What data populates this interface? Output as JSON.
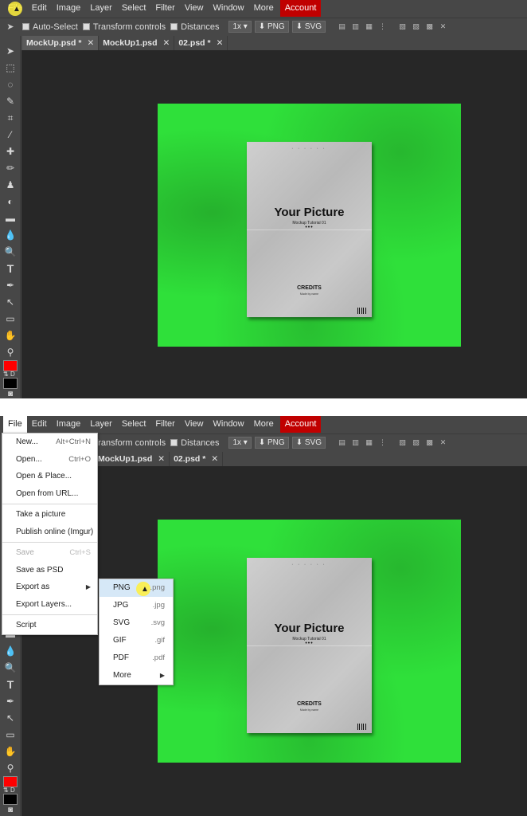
{
  "menubar": {
    "items": [
      "File",
      "Edit",
      "Image",
      "Layer",
      "Select",
      "Filter",
      "View",
      "Window",
      "More"
    ],
    "account": "Account"
  },
  "options": {
    "auto_select": "Auto-Select",
    "transform_controls": "Transform controls",
    "distances": "Distances",
    "zoom": "1x",
    "png": "PNG",
    "svg": "SVG"
  },
  "tabs": [
    {
      "label": "MockUp.psd *"
    },
    {
      "label": "MockUp1.psd"
    },
    {
      "label": "02.psd *"
    }
  ],
  "tabs_bottom": [
    {
      "label": "MockUp1.psd"
    },
    {
      "label": "02.psd *"
    }
  ],
  "colors": {
    "accent": "#c00000",
    "foreground_swatch": "#ff0000",
    "background_swatch": "#000000",
    "canvas_green": "#2fe03a"
  },
  "poster": {
    "title": "Your Picture",
    "subtitle": "Mockup Tutorial 01",
    "dots": "•••",
    "credits": "CREDITS",
    "made_by": "Made by name"
  },
  "file_menu": {
    "items": [
      {
        "label": "New...",
        "shortcut": "Alt+Ctrl+N"
      },
      {
        "label": "Open...",
        "shortcut": "Ctrl+O"
      },
      {
        "label": "Open & Place...",
        "shortcut": ""
      },
      {
        "label": "Open from URL...",
        "shortcut": ""
      },
      {
        "label": "Take a picture",
        "shortcut": ""
      },
      {
        "label": "Publish online (Imgur)",
        "shortcut": ""
      },
      {
        "label": "Save",
        "shortcut": "Ctrl+S"
      },
      {
        "label": "Save as PSD",
        "shortcut": ""
      },
      {
        "label": "Export as",
        "shortcut": ""
      },
      {
        "label": "Export Layers...",
        "shortcut": ""
      },
      {
        "label": "Script",
        "shortcut": ""
      }
    ]
  },
  "export_menu": {
    "items": [
      {
        "label": "PNG",
        "ext": ".png"
      },
      {
        "label": "JPG",
        "ext": ".jpg"
      },
      {
        "label": "SVG",
        "ext": ".svg"
      },
      {
        "label": "GIF",
        "ext": ".gif"
      },
      {
        "label": "PDF",
        "ext": ".pdf"
      },
      {
        "label": "More",
        "ext": ""
      }
    ]
  },
  "swatch_labels": {
    "swap": "⇅",
    "default": "D"
  }
}
